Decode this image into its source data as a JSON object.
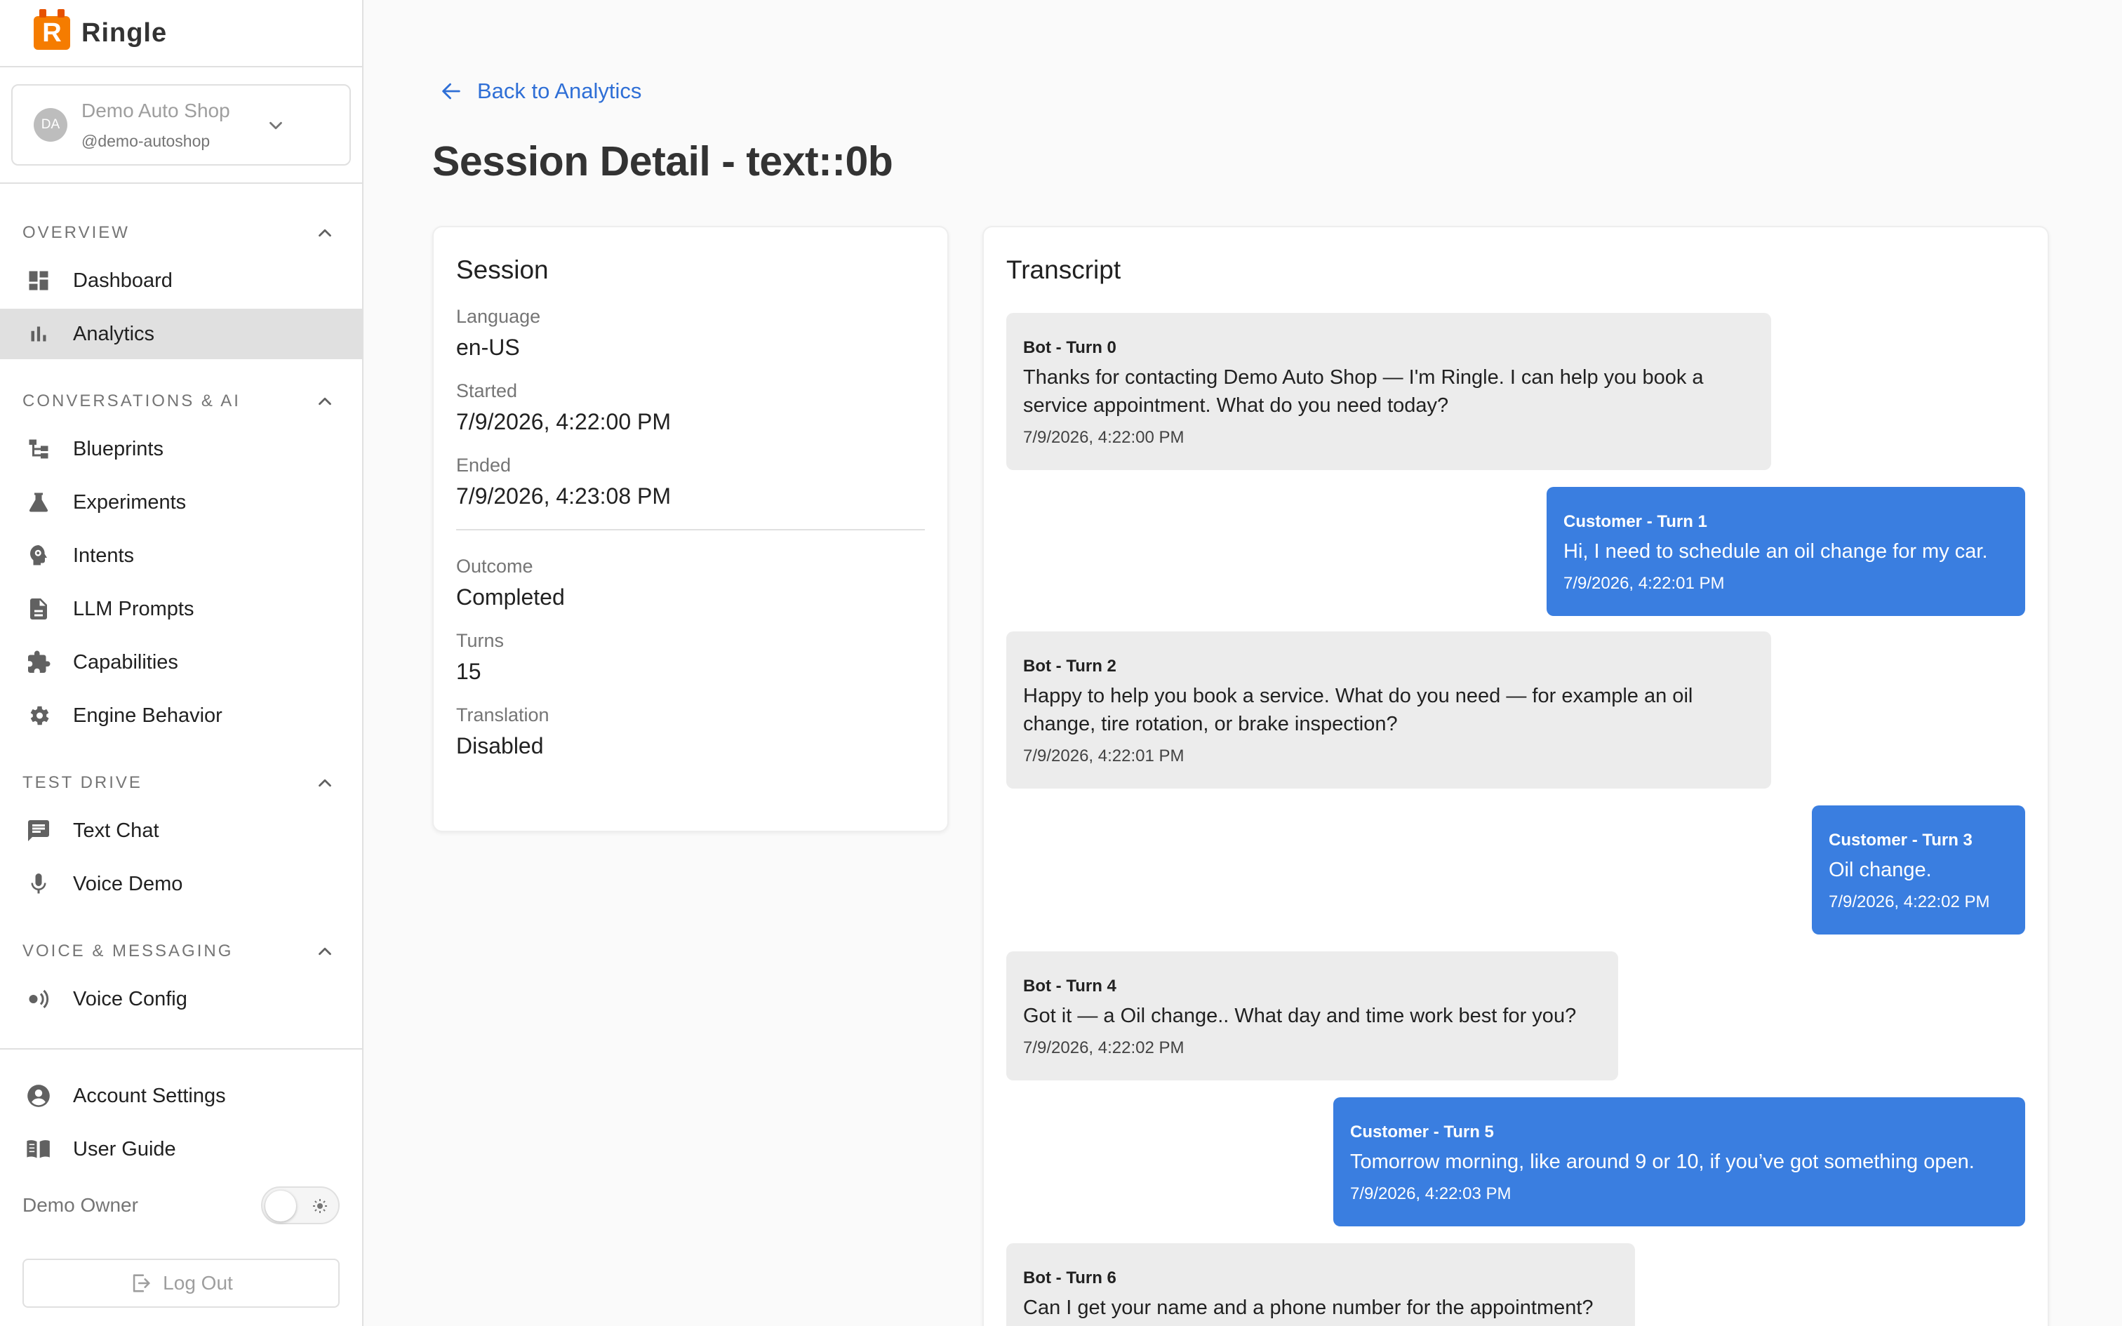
{
  "brand": {
    "logo_letter": "R",
    "name": "Ringle"
  },
  "org": {
    "avatar": "DA",
    "name": "Demo Auto Shop",
    "handle": "@demo-autoshop"
  },
  "nav": {
    "sections": [
      {
        "title": "OVERVIEW",
        "items": [
          {
            "label": "Dashboard",
            "icon": "dashboard-icon"
          },
          {
            "label": "Analytics",
            "icon": "bar-chart-icon",
            "active": true
          }
        ]
      },
      {
        "title": "CONVERSATIONS & AI",
        "items": [
          {
            "label": "Blueprints",
            "icon": "hierarchy-icon"
          },
          {
            "label": "Experiments",
            "icon": "flask-icon"
          },
          {
            "label": "Intents",
            "icon": "brain-icon"
          },
          {
            "label": "LLM Prompts",
            "icon": "document-icon"
          },
          {
            "label": "Capabilities",
            "icon": "puzzle-icon"
          },
          {
            "label": "Engine Behavior",
            "icon": "gear-icon"
          }
        ]
      },
      {
        "title": "TEST DRIVE",
        "items": [
          {
            "label": "Text Chat",
            "icon": "chat-icon"
          },
          {
            "label": "Voice Demo",
            "icon": "microphone-icon"
          }
        ]
      },
      {
        "title": "VOICE & MESSAGING",
        "items": [
          {
            "label": "Voice Config",
            "icon": "speaker-icon"
          }
        ]
      }
    ]
  },
  "bottom": {
    "account": "Account Settings",
    "guide": "User Guide",
    "user": "Demo Owner",
    "logout": "Log Out"
  },
  "page": {
    "back": "Back to Analytics",
    "title": "Session Detail - text::0b"
  },
  "session": {
    "title": "Session",
    "fields": [
      {
        "label": "Language",
        "value": "en-US"
      },
      {
        "label": "Started",
        "value": "7/9/2026, 4:22:00 PM"
      },
      {
        "label": "Ended",
        "value": "7/9/2026, 4:23:08 PM"
      },
      {
        "label": "Outcome",
        "value": "Completed"
      },
      {
        "label": "Turns",
        "value": "15"
      },
      {
        "label": "Translation",
        "value": "Disabled"
      }
    ]
  },
  "transcript": {
    "title": "Transcript",
    "turns": [
      {
        "speaker": "Bot - Turn 0",
        "text": "Thanks for contacting Demo Auto Shop — I'm Ringle. I can help you book a service appointment. What do you need today?",
        "time": "7/9/2026, 4:22:00 PM"
      },
      {
        "speaker": "Customer - Turn 1",
        "text": "Hi, I need to schedule an oil change for my car.",
        "time": "7/9/2026, 4:22:01 PM"
      },
      {
        "speaker": "Bot - Turn 2",
        "text": "Happy to help you book a service. What do you need — for example an oil change, tire rotation, or brake inspection?",
        "time": "7/9/2026, 4:22:01 PM"
      },
      {
        "speaker": "Customer - Turn 3",
        "text": "Oil change.",
        "time": "7/9/2026, 4:22:02 PM"
      },
      {
        "speaker": "Bot - Turn 4",
        "text": "Got it — a Oil change.. What day and time work best for you?",
        "time": "7/9/2026, 4:22:02 PM"
      },
      {
        "speaker": "Customer - Turn 5",
        "text": "Tomorrow morning, like around 9 or 10, if you’ve got something open.",
        "time": "7/9/2026, 4:22:03 PM"
      },
      {
        "speaker": "Bot - Turn 6",
        "text": "Can I get your name and a phone number for the appointment?",
        "time": ""
      }
    ]
  },
  "colors": {
    "accent": "#3a7ee0",
    "link": "#2f6fd6",
    "brand": "#f57c00"
  }
}
